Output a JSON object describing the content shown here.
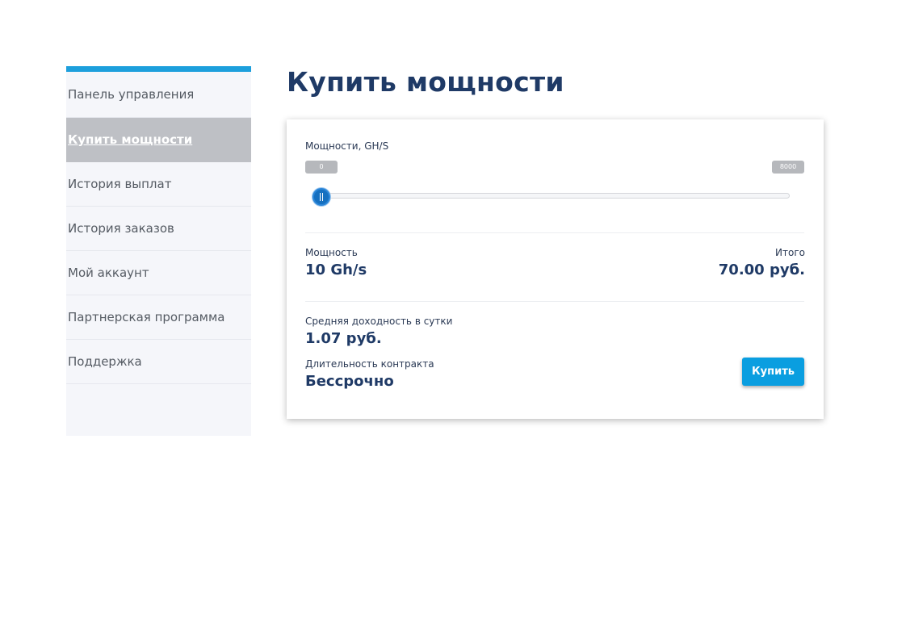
{
  "sidebar": {
    "items": [
      {
        "label": "Панель управления"
      },
      {
        "label": "Купить мощности"
      },
      {
        "label": "История выплат"
      },
      {
        "label": "История заказов"
      },
      {
        "label": "Мой аккаунт"
      },
      {
        "label": "Партнерская программа"
      },
      {
        "label": "Поддержка"
      }
    ],
    "active_index": 1
  },
  "page_title": "Купить мощности",
  "card": {
    "slider": {
      "label": "Мощности, GH/S",
      "min_label": "0",
      "max_label": "8000",
      "value": 10
    },
    "power": {
      "label": "Мощность",
      "value": "10 Gh/s"
    },
    "total": {
      "label": "Итого",
      "value": "70.00 руб."
    },
    "daily_income": {
      "label": "Средняя доходность в сутки",
      "value": "1.07 руб."
    },
    "contract": {
      "label": "Длительность контракта",
      "value": "Бессрочно"
    },
    "buy_button": "Купить"
  },
  "colors": {
    "accent": "#1d9fdc",
    "title": "#1f3a66",
    "button": "#0a9ee0",
    "active_nav": "#bec0c5"
  }
}
